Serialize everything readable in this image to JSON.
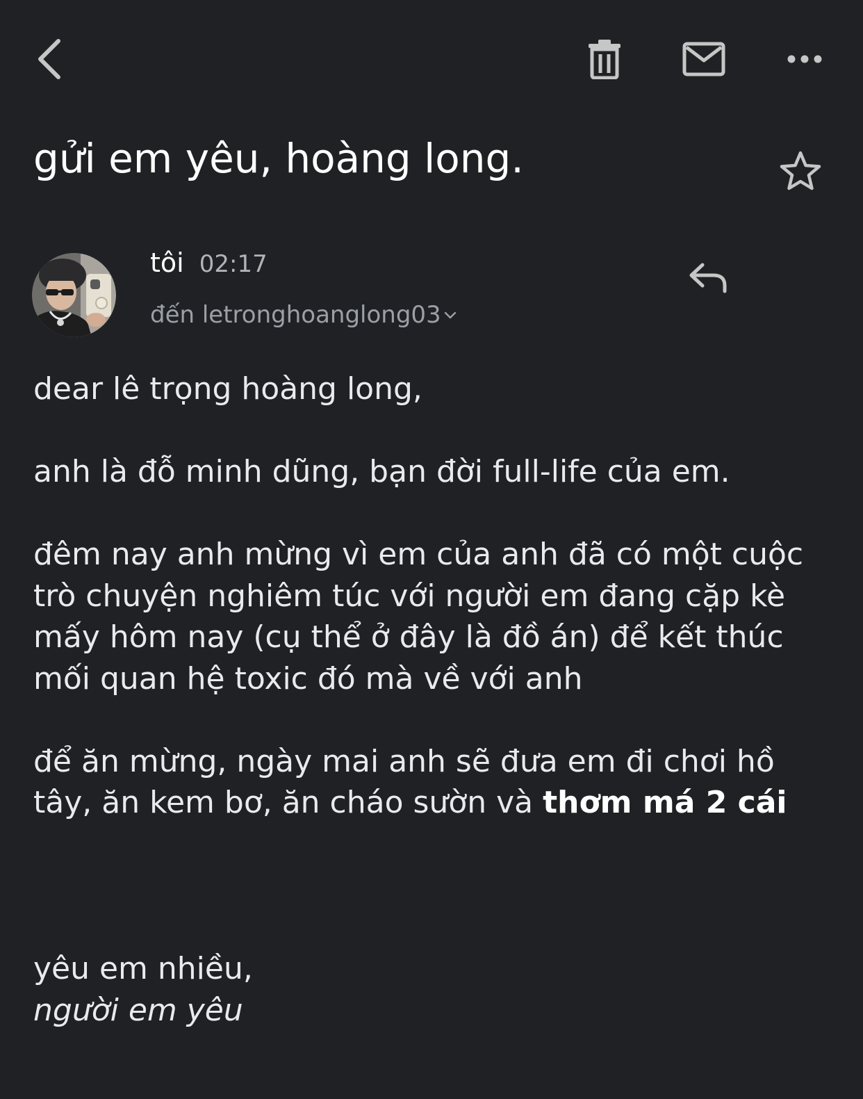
{
  "toolbar": {
    "back_icon": "chevron-left-icon",
    "delete_icon": "trash-icon",
    "mark_unread_icon": "mail-icon",
    "more_icon": "more-horizontal-icon"
  },
  "email": {
    "subject": "gửi em yêu, hoàng long.",
    "starred": false,
    "sender": {
      "name": "tôi",
      "time": "02:17",
      "recipient_text": "đến letronghoanglong03"
    },
    "body": {
      "greeting": "dear lê trọng hoàng long,",
      "paragraph1": "anh là đỗ minh dũng, bạn đời full-life của em.",
      "paragraph2": "đêm nay anh mừng vì em của anh đã có một cuộc trò chuyện nghiêm túc với người em đang cặp kè mấy hôm nay (cụ thể ở đây là đồ án) để kết thúc mối quan hệ toxic đó mà về với anh",
      "paragraph3_plain": "để ăn mừng, ngày mai anh sẽ đưa em đi chơi hồ tây, ăn kem bơ, ăn cháo sườn và ",
      "paragraph3_bold": "thơm má 2 cái",
      "closing_line": "yêu em nhiều,",
      "signature": "người em yêu"
    }
  },
  "colors": {
    "background": "#202124",
    "text_primary": "#e8eaed",
    "text_secondary": "#9aa0a6",
    "icon": "#c4c7c5"
  }
}
